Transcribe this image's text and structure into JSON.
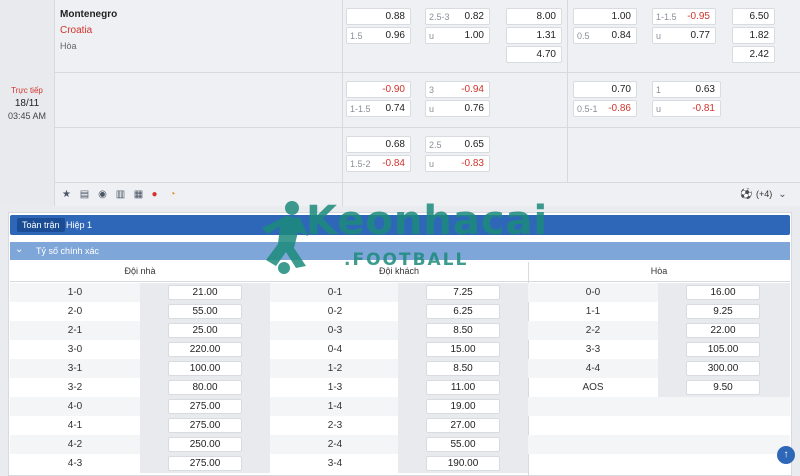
{
  "match": {
    "status": "Trực tiếp",
    "date": "18/11",
    "time": "03:45 AM",
    "home": "Montenegro",
    "away": "Croatia",
    "draw": "Hòa"
  },
  "odds_rows": [
    {
      "ft_hdp": {
        "home_hc": "",
        "home": "0.88",
        "away_hc": "1.5",
        "away": "0.96",
        "home_red": false,
        "away_red": false
      },
      "ft_ou": {
        "line": "2.5-3",
        "over": "0.82",
        "u": "u",
        "under": "1.00",
        "over_red": false,
        "under_red": false
      },
      "ft_1x2": [
        "8.00",
        "1.31",
        "4.70"
      ],
      "h1_hdp": {
        "home_hc": "",
        "home": "1.00",
        "away_hc": "0.5",
        "away": "0.84",
        "home_red": false,
        "away_red": false
      },
      "h1_ou": {
        "line": "1-1.5",
        "over": "-0.95",
        "u": "u",
        "under": "0.77",
        "over_red": true,
        "under_red": false
      },
      "h1_1x2": [
        "6.50",
        "1.82",
        "2.42"
      ]
    },
    {
      "ft_hdp": {
        "home_hc": "",
        "home": "-0.90",
        "away_hc": "1-1.5",
        "away": "0.74",
        "home_red": true,
        "away_red": false
      },
      "ft_ou": {
        "line": "3",
        "over": "-0.94",
        "u": "u",
        "under": "0.76",
        "over_red": true,
        "under_red": false
      },
      "h1_hdp": {
        "home_hc": "",
        "home": "0.70",
        "away_hc": "0.5-1",
        "away": "-0.86",
        "home_red": false,
        "away_red": true
      },
      "h1_ou": {
        "line": "1",
        "over": "0.63",
        "u": "u",
        "under": "-0.81",
        "over_red": false,
        "under_red": true
      }
    },
    {
      "ft_hdp": {
        "home_hc": "",
        "home": "0.68",
        "away_hc": "1.5-2",
        "away": "-0.84",
        "home_red": false,
        "away_red": true
      },
      "ft_ou": {
        "line": "2.5",
        "over": "0.65",
        "u": "u",
        "under": "-0.83",
        "over_red": false,
        "under_red": true
      }
    }
  ],
  "more_markets": "(+4)",
  "tabs": {
    "full": "Toàn trận",
    "half": "Hiệp 1"
  },
  "section_title": "Tỷ số chính xác",
  "columns": {
    "home": "Đội nhà",
    "away": "Đội khách",
    "draw": "Hòa"
  },
  "home_scores": [
    {
      "s": "1-0",
      "o": "21.00"
    },
    {
      "s": "2-0",
      "o": "55.00"
    },
    {
      "s": "2-1",
      "o": "25.00"
    },
    {
      "s": "3-0",
      "o": "220.00"
    },
    {
      "s": "3-1",
      "o": "100.00"
    },
    {
      "s": "3-2",
      "o": "80.00"
    },
    {
      "s": "4-0",
      "o": "275.00"
    },
    {
      "s": "4-1",
      "o": "275.00"
    },
    {
      "s": "4-2",
      "o": "250.00"
    },
    {
      "s": "4-3",
      "o": "275.00"
    }
  ],
  "away_scores": [
    {
      "s": "0-1",
      "o": "7.25"
    },
    {
      "s": "0-2",
      "o": "6.25"
    },
    {
      "s": "0-3",
      "o": "8.50"
    },
    {
      "s": "0-4",
      "o": "15.00"
    },
    {
      "s": "1-2",
      "o": "8.50"
    },
    {
      "s": "1-3",
      "o": "11.00"
    },
    {
      "s": "1-4",
      "o": "19.00"
    },
    {
      "s": "2-3",
      "o": "27.00"
    },
    {
      "s": "2-4",
      "o": "55.00"
    },
    {
      "s": "3-4",
      "o": "190.00"
    }
  ],
  "draw_scores": [
    {
      "s": "0-0",
      "o": "16.00"
    },
    {
      "s": "1-1",
      "o": "9.25"
    },
    {
      "s": "2-2",
      "o": "22.00"
    },
    {
      "s": "3-3",
      "o": "105.00"
    },
    {
      "s": "4-4",
      "o": "300.00"
    },
    {
      "s": "AOS",
      "o": "9.50"
    }
  ],
  "watermark": {
    "main": "Keonhacai",
    "sub": ".FOOTBALL"
  },
  "colors": {
    "accent": "#2f67b8",
    "section": "#7fa6d9",
    "red": "#d0342c",
    "live": "#d0342c"
  }
}
